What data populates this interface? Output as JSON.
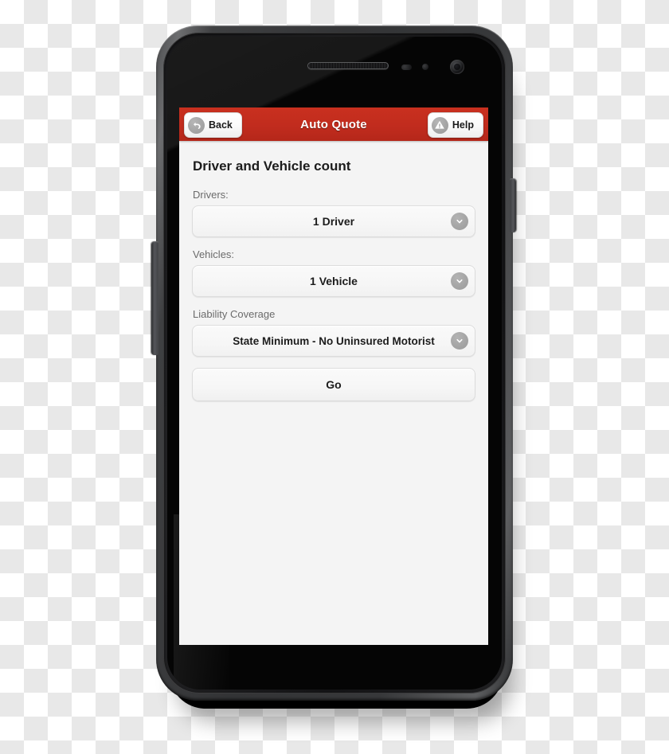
{
  "device": {
    "type": "smartphone-mockup",
    "hardware": {
      "earpiece": "earpiece-speaker",
      "proximity_sensor": "proximity-sensor",
      "light_sensor": "light-sensor",
      "front_camera": "front-camera",
      "volume_button": "volume-rocker",
      "power_button": "power-button"
    }
  },
  "app": {
    "header": {
      "title": "Auto Quote",
      "accent_color": "#C22D20",
      "back": {
        "label": "Back",
        "icon": "back-arrow-icon"
      },
      "help": {
        "label": "Help",
        "icon": "warning-triangle-icon"
      }
    },
    "page": {
      "title": "Driver and Vehicle count",
      "background_color": "#F4F4F4",
      "fields": [
        {
          "label": "Drivers:",
          "value": "1 Driver",
          "icon": "chevron-down-icon"
        },
        {
          "label": "Vehicles:",
          "value": "1 Vehicle",
          "icon": "chevron-down-icon"
        },
        {
          "label": "Liability Coverage",
          "value": "State Minimum - No Uninsured Motorist",
          "icon": "chevron-down-icon"
        }
      ],
      "submit": {
        "label": "Go"
      }
    }
  }
}
